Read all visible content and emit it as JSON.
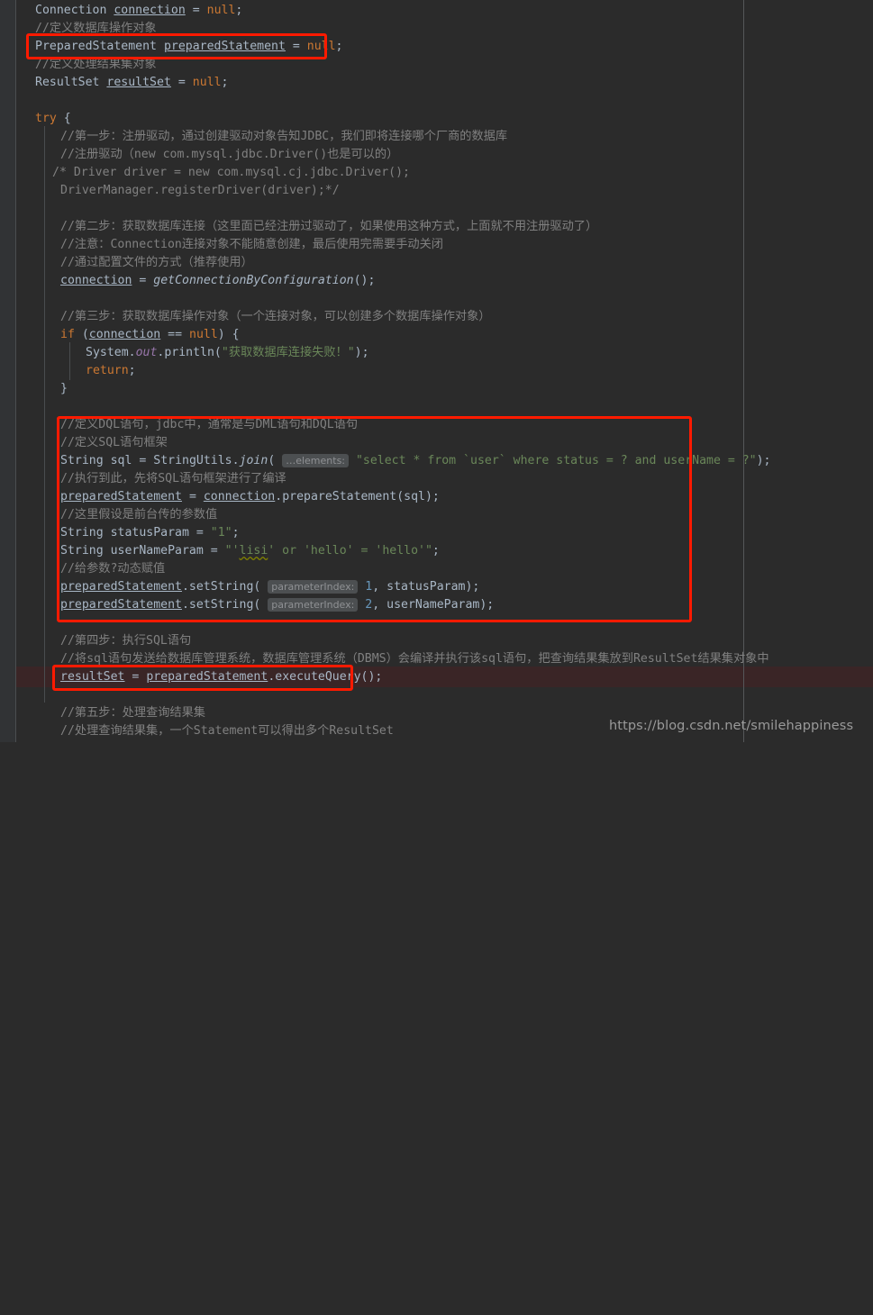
{
  "editor": {
    "theme": "darcula",
    "background": "#2b2b2b",
    "gutter_color": "#313335",
    "accent_box_color": "#ff1a00",
    "current_line_color": "#3a2526",
    "keyword_color": "#cc7832",
    "string_color": "#6a8759",
    "comment_color": "#808080",
    "number_color": "#6897bb",
    "field_color": "#9876aa",
    "identifier_color": "#a9b7c6"
  },
  "watermark": {
    "text": "https://blog.csdn.net/smilehappiness"
  },
  "inlay_hints": {
    "elements": "…elements:",
    "parameter_index": "parameterIndex:"
  },
  "code_lines": [
    {
      "id": "l1",
      "indent": 3,
      "text": "Connection connection = null;"
    },
    {
      "id": "l2",
      "indent": 3,
      "text": "//定义数据库操作对象"
    },
    {
      "id": "l3",
      "indent": 3,
      "text": "PreparedStatement preparedStatement = null;"
    },
    {
      "id": "l4",
      "indent": 3,
      "text": "//定义处理结果集对象"
    },
    {
      "id": "l5",
      "indent": 3,
      "text": "ResultSet resultSet = null;"
    },
    {
      "id": "l6",
      "indent": 0,
      "text": ""
    },
    {
      "id": "l7",
      "indent": 3,
      "text": "try {"
    },
    {
      "id": "l8",
      "indent": 5,
      "text": "//第一步：注册驱动，通过创建驱动对象告知JDBC，我们即将连接哪个厂商的数据库"
    },
    {
      "id": "l9",
      "indent": 5,
      "text": "//注册驱动（new com.mysql.jdbc.Driver()也是可以的）"
    },
    {
      "id": "l10",
      "indent": 4,
      "text": "/* Driver driver = new com.mysql.cj.jdbc.Driver();"
    },
    {
      "id": "l11",
      "indent": 5,
      "text": "DriverManager.registerDriver(driver);*/"
    },
    {
      "id": "l12",
      "indent": 0,
      "text": ""
    },
    {
      "id": "l13",
      "indent": 5,
      "text": "//第二步：获取数据库连接（这里面已经注册过驱动了，如果使用这种方式，上面就不用注册驱动了）"
    },
    {
      "id": "l14",
      "indent": 5,
      "text": "//注意：Connection连接对象不能随意创建，最后使用完需要手动关闭"
    },
    {
      "id": "l15",
      "indent": 5,
      "text": "//通过配置文件的方式（推荐使用）"
    },
    {
      "id": "l16",
      "indent": 5,
      "text": "connection = getConnectionByConfiguration();"
    },
    {
      "id": "l17",
      "indent": 0,
      "text": ""
    },
    {
      "id": "l18",
      "indent": 5,
      "text": "//第三步：获取数据库操作对象（一个连接对象，可以创建多个数据库操作对象）"
    },
    {
      "id": "l19",
      "indent": 5,
      "text": "if (connection == null) {"
    },
    {
      "id": "l20",
      "indent": 7,
      "text": "System.out.println(\"获取数据库连接失败！\");"
    },
    {
      "id": "l21",
      "indent": 7,
      "text": "return;"
    },
    {
      "id": "l22",
      "indent": 5,
      "text": "}"
    },
    {
      "id": "l23",
      "indent": 0,
      "text": ""
    },
    {
      "id": "l24",
      "indent": 5,
      "text": "//定义DQL语句，jdbc中，通常是与DML语句和DQL语句"
    },
    {
      "id": "l25",
      "indent": 5,
      "text": "//定义SQL语句框架"
    },
    {
      "id": "l26",
      "indent": 5,
      "text": "String sql = StringUtils.join( …elements: \"select * from `user` where status = ? and userName = ?\");"
    },
    {
      "id": "l27",
      "indent": 5,
      "text": "//执行到此，先将SQL语句框架进行了编译"
    },
    {
      "id": "l28",
      "indent": 5,
      "text": "preparedStatement = connection.prepareStatement(sql);"
    },
    {
      "id": "l29",
      "indent": 5,
      "text": "//这里假设是前台传的参数值"
    },
    {
      "id": "l30",
      "indent": 5,
      "text": "String statusParam = \"1\";"
    },
    {
      "id": "l31",
      "indent": 5,
      "text": "String userNameParam = \"'lisi' or 'hello' = 'hello'\";"
    },
    {
      "id": "l32",
      "indent": 5,
      "text": "//给参数?动态赋值"
    },
    {
      "id": "l33",
      "indent": 5,
      "text": "preparedStatement.setString( parameterIndex: 1, statusParam);"
    },
    {
      "id": "l34",
      "indent": 5,
      "text": "preparedStatement.setString( parameterIndex: 2, userNameParam);"
    },
    {
      "id": "l35",
      "indent": 0,
      "text": ""
    },
    {
      "id": "l36",
      "indent": 5,
      "text": "//第四步：执行SQL语句"
    },
    {
      "id": "l37",
      "indent": 5,
      "text": "//将sql语句发送给数据库管理系统，数据库管理系统（DBMS）会编译并执行该sql语句，把查询结果集放到ResultSet结果集对象中"
    },
    {
      "id": "l38",
      "indent": 5,
      "text": "resultSet = preparedStatement.executeQuery();"
    },
    {
      "id": "l39",
      "indent": 0,
      "text": ""
    },
    {
      "id": "l40",
      "indent": 5,
      "text": "//第五步：处理查询结果集"
    },
    {
      "id": "l41",
      "indent": 5,
      "text": "//处理查询结果集，一个Statement可以得出多个ResultSet"
    }
  ],
  "annotations": [
    {
      "id": "box1",
      "label": "prepared-statement-declaration-highlight"
    },
    {
      "id": "box2",
      "label": "sql-preparation-block-highlight"
    },
    {
      "id": "box3",
      "label": "execute-query-highlight"
    }
  ]
}
